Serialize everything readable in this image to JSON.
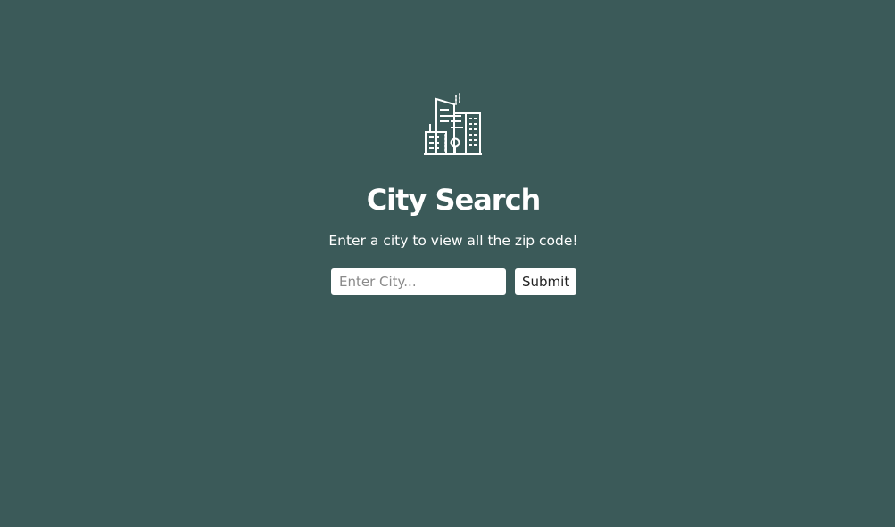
{
  "header": {
    "logo_icon": "city-buildings-icon",
    "title": "City Search",
    "subtitle": "Enter a city to view all the zip code!"
  },
  "search": {
    "input_value": "",
    "placeholder": "Enter City...",
    "submit_label": "Submit"
  },
  "colors": {
    "background": "#3b5a59",
    "text": "#ffffff",
    "input_background": "#ffffff",
    "button_background": "#ffffff"
  }
}
